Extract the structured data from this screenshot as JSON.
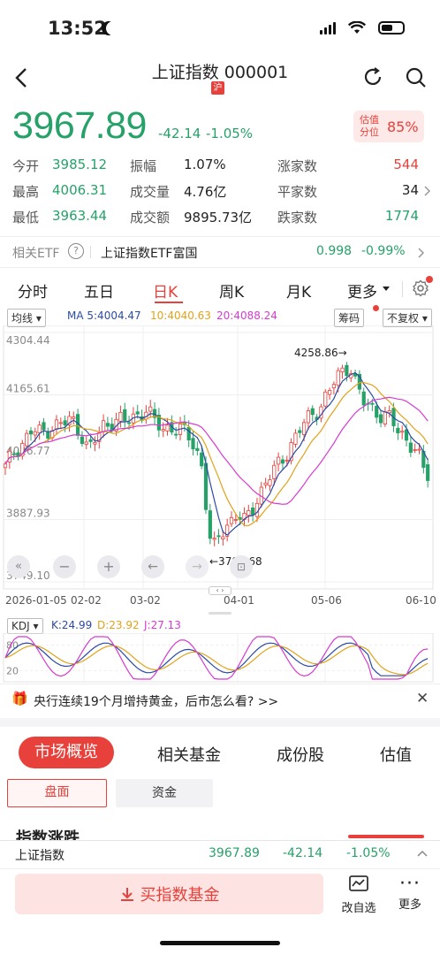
{
  "status": {
    "time": "13:52"
  },
  "header": {
    "title": "上证指数 000001",
    "market_badge": "沪"
  },
  "quote": {
    "price": "3967.89",
    "change": "-42.14",
    "change_pct": "-1.05%"
  },
  "valuation": {
    "label_line1": "估值",
    "label_line2": "分位",
    "value": "85%"
  },
  "stats": {
    "open_label": "今开",
    "open": "3985.12",
    "amp_label": "振幅",
    "amp": "1.07%",
    "up_label": "涨家数",
    "up": "544",
    "high_label": "最高",
    "high": "4006.31",
    "vol_label": "成交量",
    "vol": "4.76亿",
    "flat_label": "平家数",
    "flat": "34",
    "low_label": "最低",
    "low": "3963.44",
    "amt_label": "成交额",
    "amt": "9895.73亿",
    "down_label": "跌家数",
    "down": "1774"
  },
  "etf": {
    "label": "相关ETF",
    "name": "上证指数ETF富国",
    "price": "0.998",
    "change_pct": "-0.99%"
  },
  "period_tabs": [
    "分时",
    "五日",
    "日K",
    "周K",
    "月K",
    "更多"
  ],
  "chart_toolbar": {
    "ma_select": "均线",
    "ma5": "MA 5:4004.47",
    "ma10": "10:4040.63",
    "ma20": "20:4088.24",
    "chips": "筹码",
    "adjust": "不复权"
  },
  "chart_data": {
    "type": "candlestick",
    "y_ticks": [
      "4304.44",
      "4165.61",
      "4026.77",
      "3887.93",
      "3749.10"
    ],
    "x_ticks": [
      "2026-01-05",
      "02-02",
      "03-02",
      "04-01",
      "05-06",
      "06-10"
    ],
    "ylim": [
      3749.1,
      4304.44
    ],
    "annotations": [
      {
        "text": "4258.86",
        "value": 4258.86
      },
      {
        "text": "3794.68",
        "value": 3794.68
      }
    ],
    "kdj": {
      "label": "KDJ",
      "K": "K:24.99",
      "D": "D:23.92",
      "J": "J:27.13",
      "ticks": [
        "80",
        "20"
      ]
    }
  },
  "news": {
    "text": "央行连续19个月增持黄金，后市怎么看? >>"
  },
  "section_tabs": [
    "市场概览",
    "相关基金",
    "成份股",
    "估值"
  ],
  "sub_tabs": [
    "盘面",
    "资金"
  ],
  "partial_heading": "指数涨跌",
  "bottom_ticker": {
    "name": "上证指数",
    "price": "3967.89",
    "change": "-42.14",
    "change_pct": "-1.05%"
  },
  "bottom_actions": {
    "buy": "买指数基金",
    "edit": "改自选",
    "more": "更多"
  },
  "colors": {
    "up": "#e8413b",
    "down": "#26a269",
    "accent": "#e8413b"
  }
}
